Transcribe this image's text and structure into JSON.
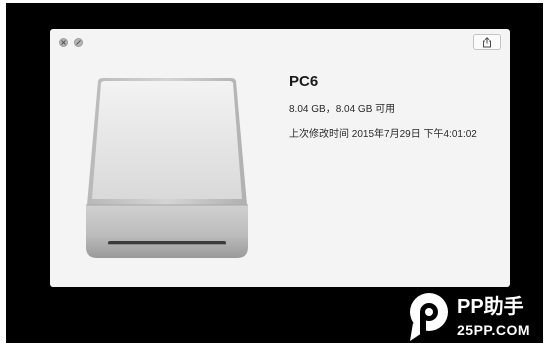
{
  "window": {
    "controls": {
      "close_icon": "close-icon",
      "minimize_icon": "minimize-icon"
    },
    "toolbar": {
      "share_icon": "share-icon"
    }
  },
  "drive": {
    "icon": "external-drive-icon",
    "name": "PC6",
    "size_info": "8.04 GB，8.04 GB 可用",
    "modified": "上次修改时间 2015年7月29日 下午4:01:02"
  },
  "watermark": {
    "title": "PP助手",
    "url": "25PP.COM"
  },
  "colors": {
    "screen_background": "#000000",
    "window_background": "#f4f4f4",
    "text_primary": "#1a1a1a",
    "watermark_text": "#ffffff"
  }
}
